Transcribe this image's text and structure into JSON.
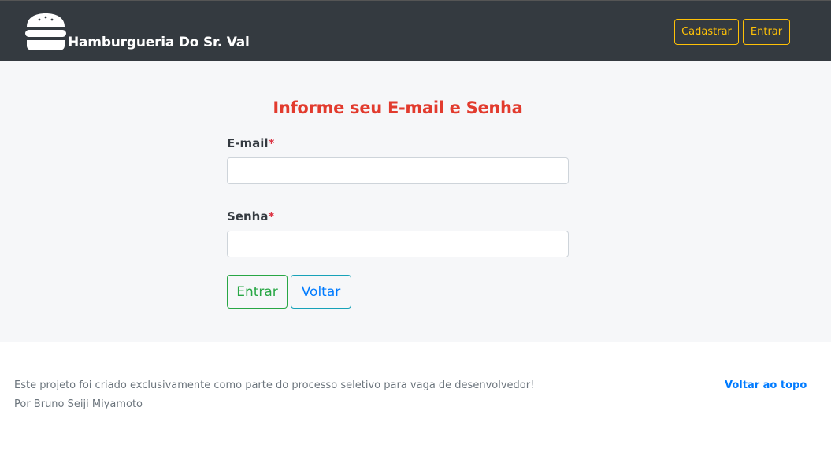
{
  "navbar": {
    "brand": "Hamburgueria Do Sr. Val",
    "brand_icon": "burger-icon",
    "buttons": {
      "cadastrar": "Cadastrar",
      "entrar": "Entrar"
    },
    "accent_color": "#ffc107",
    "background": "#343a40"
  },
  "form": {
    "title": "Informe seu E-mail e Senha",
    "email_label": "E-mail",
    "senha_label": "Senha",
    "required_marker": "*",
    "email_value": "",
    "senha_value": "",
    "submit_label": "Entrar",
    "back_label": "Voltar",
    "title_color": "#e23b2e"
  },
  "footer": {
    "line1": "Este projeto foi criado exclusivamente como parte do processo seletivo para vaga de desenvolvedor!",
    "line2": "Por Bruno Seiji Miyamoto",
    "back_to_top": "Voltar ao topo"
  }
}
